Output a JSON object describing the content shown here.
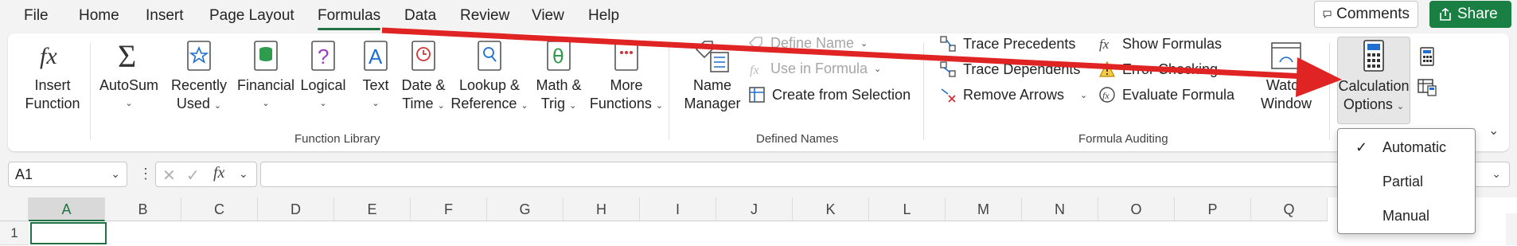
{
  "menu": {
    "items": [
      "File",
      "Home",
      "Insert",
      "Page Layout",
      "Formulas",
      "Data",
      "Review",
      "View",
      "Help"
    ],
    "active": "Formulas"
  },
  "top_buttons": {
    "comments": "Comments",
    "share": "Share"
  },
  "function_library": {
    "insert_function": [
      "Insert",
      "Function"
    ],
    "autosum": "AutoSum",
    "recently_used": [
      "Recently",
      "Used"
    ],
    "financial": "Financial",
    "logical": "Logical",
    "text": "Text",
    "date_time": [
      "Date &",
      "Time"
    ],
    "lookup": [
      "Lookup &",
      "Reference"
    ],
    "math": [
      "Math &",
      "Trig"
    ],
    "more": [
      "More",
      "Functions"
    ],
    "label": "Function Library"
  },
  "defined_names": {
    "name_manager": [
      "Name",
      "Manager"
    ],
    "define_name": "Define Name",
    "use_in_formula": "Use in Formula",
    "create_from_selection": "Create from Selection",
    "label": "Defined Names"
  },
  "formula_auditing": {
    "trace_precedents": "Trace Precedents",
    "trace_dependents": "Trace Dependents",
    "remove_arrows": "Remove Arrows",
    "show_formulas": "Show Formulas",
    "error_checking": "Error Checking",
    "evaluate_formula": "Evaluate Formula",
    "watch_window": [
      "Watch",
      "Window"
    ],
    "label": "Formula Auditing"
  },
  "calculation": {
    "options": [
      "Calculation",
      "Options"
    ]
  },
  "dropdown": {
    "automatic": "Automatic",
    "partial": "Partial",
    "manual": "Manual"
  },
  "formula_bar": {
    "name_box": "A1",
    "fx": "fx"
  },
  "grid": {
    "columns": [
      "A",
      "B",
      "C",
      "D",
      "E",
      "F",
      "G",
      "H",
      "I",
      "J",
      "K",
      "L",
      "M",
      "N",
      "O",
      "P",
      "Q"
    ],
    "row": "1"
  },
  "colors": {
    "accent": "#217346",
    "arrow": "#e02424"
  }
}
